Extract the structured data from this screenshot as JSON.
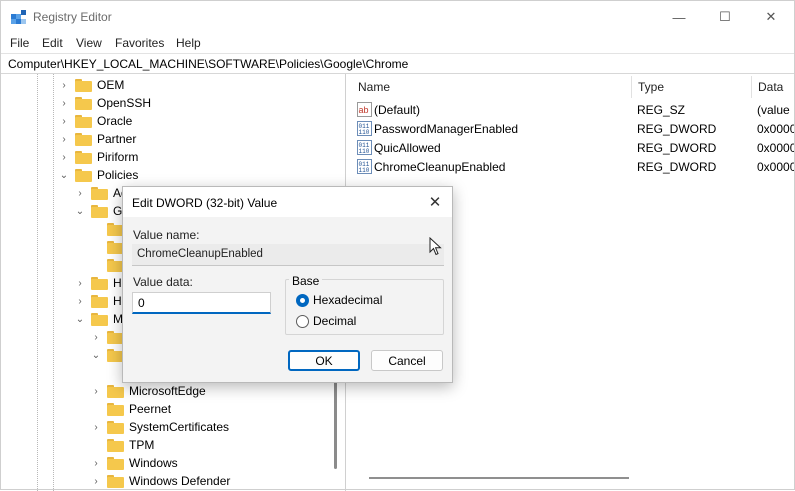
{
  "window": {
    "title": "Registry Editor",
    "controls": {
      "minimize": "—",
      "maximize": "☐",
      "close": "✕"
    }
  },
  "menu": [
    "File",
    "Edit",
    "View",
    "Favorites",
    "Help"
  ],
  "address": "Computer\\HKEY_LOCAL_MACHINE\\SOFTWARE\\Policies\\Google\\Chrome",
  "tree": {
    "items": [
      {
        "label": "OEM",
        "chevron": "›"
      },
      {
        "label": "OpenSSH",
        "chevron": "›"
      },
      {
        "label": "Oracle",
        "chevron": "›"
      },
      {
        "label": "Partner",
        "chevron": "›"
      },
      {
        "label": "Piriform",
        "chevron": "›"
      },
      {
        "label": "Policies",
        "chevron": "⌄"
      },
      {
        "label": "Ad",
        "chevron": "›"
      },
      {
        "label": "Go",
        "chevron": "⌄"
      },
      {
        "label": "",
        "chevron": ""
      },
      {
        "label": "",
        "chevron": ""
      },
      {
        "label": "",
        "chevron": ""
      },
      {
        "label": "He",
        "chevron": "›"
      },
      {
        "label": "HP",
        "chevron": "›"
      },
      {
        "label": "Mi",
        "chevron": "⌄"
      },
      {
        "label": "",
        "chevron": "›"
      },
      {
        "label": "",
        "chevron": "⌄"
      },
      {
        "label": "",
        "chevron": ""
      },
      {
        "label": "MicrosoftEdge",
        "chevron": "›"
      },
      {
        "label": "Peernet",
        "chevron": ""
      },
      {
        "label": "SystemCertificates",
        "chevron": "›"
      },
      {
        "label": "TPM",
        "chevron": ""
      },
      {
        "label": "Windows",
        "chevron": "›"
      },
      {
        "label": "Windows Defender",
        "chevron": "›"
      }
    ]
  },
  "list": {
    "columns": [
      "Name",
      "Type",
      "Data"
    ],
    "rows": [
      {
        "name": "(Default)",
        "type": "REG_SZ",
        "data": "(value",
        "icon": "string-value-icon"
      },
      {
        "name": "PasswordManagerEnabled",
        "type": "REG_DWORD",
        "data": "0x0000",
        "icon": "dword-value-icon"
      },
      {
        "name": "QuicAllowed",
        "type": "REG_DWORD",
        "data": "0x0000",
        "icon": "dword-value-icon"
      },
      {
        "name": "ChromeCleanupEnabled",
        "type": "REG_DWORD",
        "data": "0x0000",
        "icon": "dword-value-icon"
      }
    ]
  },
  "dialog": {
    "title": "Edit DWORD (32-bit) Value",
    "close": "✕",
    "value_name_label": "Value name:",
    "value_name": "ChromeCleanupEnabled",
    "value_data_label": "Value data:",
    "value_data": "0",
    "base_label": "Base",
    "base_options": [
      "Hexadecimal",
      "Decimal"
    ],
    "base_selected": "Hexadecimal",
    "ok_label": "OK",
    "cancel_label": "Cancel"
  },
  "colors": {
    "accent": "#0067c0",
    "folder": "#f5c84c"
  }
}
